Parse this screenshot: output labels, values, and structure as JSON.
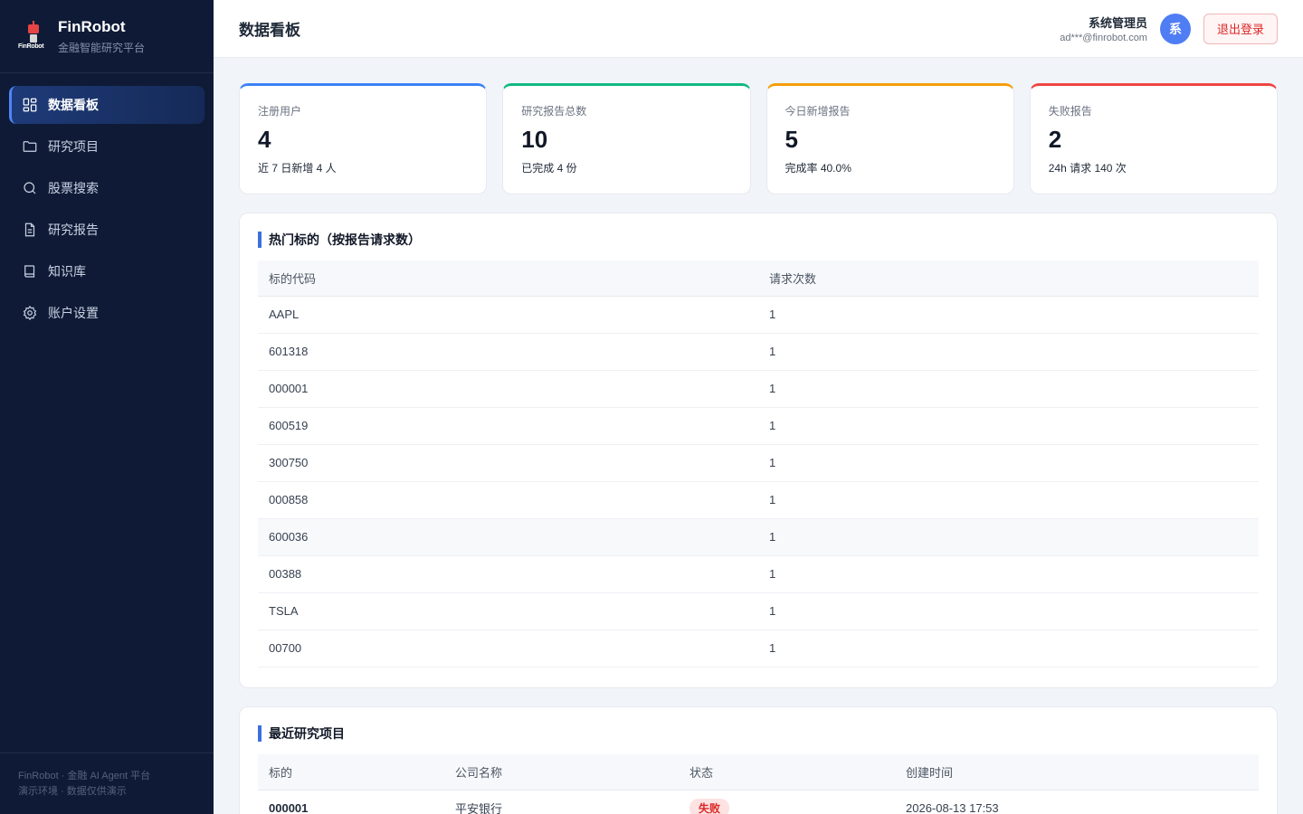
{
  "sidebar": {
    "brand_name": "FinRobot",
    "brand_sub": "金融智能研究平台",
    "logo_text": "FinRobot",
    "items": [
      {
        "label": "数据看板",
        "icon": "dashboard-icon"
      },
      {
        "label": "研究项目",
        "icon": "folder-icon"
      },
      {
        "label": "股票搜索",
        "icon": "search-icon"
      },
      {
        "label": "研究报告",
        "icon": "file-icon"
      },
      {
        "label": "知识库",
        "icon": "book-icon"
      },
      {
        "label": "账户设置",
        "icon": "gear-icon"
      }
    ],
    "footer_line1": "FinRobot · 金融 AI Agent 平台",
    "footer_line2": "演示环境 · 数据仅供演示"
  },
  "header": {
    "title": "数据看板",
    "user_name": "系统管理员",
    "user_email": "ad***@finrobot.com",
    "avatar_text": "系",
    "logout_label": "退出登录"
  },
  "stats": [
    {
      "label": "注册用户",
      "value": "4",
      "sub": "近 7 日新增 4 人",
      "color": "#3b82f6"
    },
    {
      "label": "研究报告总数",
      "value": "10",
      "sub": "已完成 4 份",
      "color": "#10b981"
    },
    {
      "label": "今日新增报告",
      "value": "5",
      "sub": "完成率 40.0%",
      "color": "#f59e0b"
    },
    {
      "label": "失败报告",
      "value": "2",
      "sub": "24h 请求 140 次",
      "color": "#ef4444"
    }
  ],
  "hot": {
    "title": "热门标的（按报告请求数）",
    "columns": [
      "标的代码",
      "请求次数"
    ],
    "rows": [
      [
        "AAPL",
        "1"
      ],
      [
        "601318",
        "1"
      ],
      [
        "000001",
        "1"
      ],
      [
        "600519",
        "1"
      ],
      [
        "300750",
        "1"
      ],
      [
        "000858",
        "1"
      ],
      [
        "600036",
        "1"
      ],
      [
        "00388",
        "1"
      ],
      [
        "TSLA",
        "1"
      ],
      [
        "00700",
        "1"
      ]
    ]
  },
  "recent": {
    "title": "最近研究项目",
    "columns": [
      "标的",
      "公司名称",
      "状态",
      "创建时间"
    ],
    "rows": [
      [
        "000001",
        "平安银行",
        "失败",
        "2026-08-13 17:53"
      ]
    ]
  }
}
